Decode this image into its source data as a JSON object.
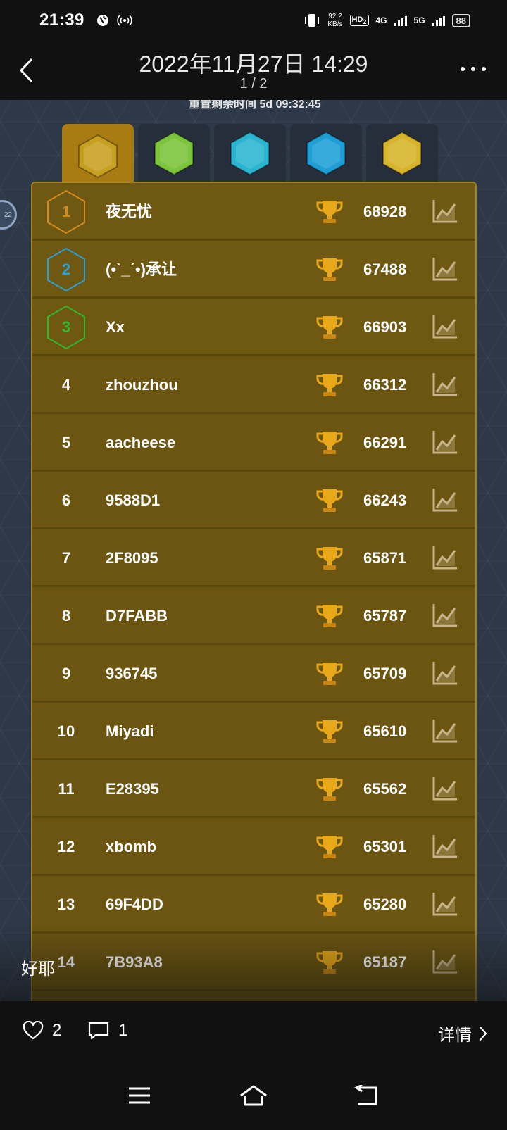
{
  "status_bar": {
    "time": "21:39",
    "speed_value": "92.2",
    "speed_unit": "KB/s",
    "hd_label": "HD",
    "hd_sub": "2",
    "net1": "4G",
    "net2": "5G",
    "battery": "88"
  },
  "header": {
    "title": "2022年11月27日 14:29",
    "page_indicator": "1 / 2"
  },
  "screenshot": {
    "top_text": "重置剩余时间 5d 09:32:45",
    "side_badge": "22",
    "tabs": [
      {
        "name": "mountain-tab",
        "icon": "mountain-icon",
        "color": "#c8a020",
        "active": true
      },
      {
        "name": "grassland-tab",
        "icon": "grass-icon",
        "color": "#7cc43a",
        "active": false
      },
      {
        "name": "ocean-map-tab",
        "icon": "world-map-icon",
        "color": "#2ab6d0",
        "active": false
      },
      {
        "name": "island-tab",
        "icon": "palm-tree-icon",
        "color": "#1d9fd6",
        "active": false
      },
      {
        "name": "desert-tab",
        "icon": "desert-icon",
        "color": "#d8b42a",
        "active": false
      }
    ],
    "leaderboard": [
      {
        "rank": "1",
        "player": "夜无忧",
        "score": "68928",
        "medal": "#d28a1e"
      },
      {
        "rank": "2",
        "player": "(•ˋ_ˊ•)承让",
        "score": "67488",
        "medal": "#2a9fd8"
      },
      {
        "rank": "3",
        "player": "Xx",
        "score": "66903",
        "medal": "#2db82d"
      },
      {
        "rank": "4",
        "player": "zhouzhou",
        "score": "66312"
      },
      {
        "rank": "5",
        "player": "aacheese",
        "score": "66291"
      },
      {
        "rank": "6",
        "player": "9588D1",
        "score": "66243"
      },
      {
        "rank": "7",
        "player": "2F8095",
        "score": "65871"
      },
      {
        "rank": "8",
        "player": "D7FABB",
        "score": "65787"
      },
      {
        "rank": "9",
        "player": "936745",
        "score": "65709"
      },
      {
        "rank": "10",
        "player": "Miyadi",
        "score": "65610"
      },
      {
        "rank": "11",
        "player": "E28395",
        "score": "65562"
      },
      {
        "rank": "12",
        "player": "xbomb",
        "score": "65301"
      },
      {
        "rank": "13",
        "player": "69F4DD",
        "score": "65280"
      },
      {
        "rank": "14",
        "player": "7B93A8",
        "score": "65187"
      }
    ]
  },
  "post": {
    "caption": "好耶",
    "likes": "2",
    "comments": "1",
    "details_label": "详情"
  },
  "colors": {
    "panel": "#6b5510",
    "active_tab": "#a87c12",
    "trophy": "#e8a818"
  }
}
